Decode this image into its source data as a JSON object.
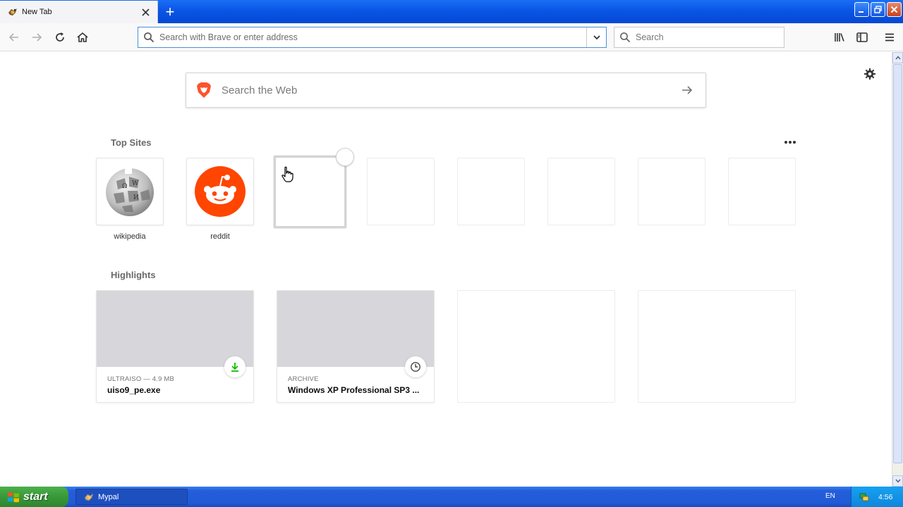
{
  "window": {
    "tab_title": "New Tab",
    "new_tab_symbol": "+"
  },
  "toolbar": {
    "address_placeholder": "Search with Brave or enter address",
    "search_placeholder": "Search"
  },
  "content": {
    "web_search_placeholder": "Search the Web",
    "top_sites_title": "Top Sites",
    "top_sites": [
      {
        "label": "wikipedia",
        "icon": "wikipedia-globe-icon"
      },
      {
        "label": "reddit",
        "icon": "reddit-alien-icon"
      }
    ],
    "highlights_title": "Highlights",
    "highlights": [
      {
        "meta": "ULTRAISO — 4.9 MB",
        "title": "uiso9_pe.exe",
        "badge_icon": "download-icon"
      },
      {
        "meta": "ARCHIVE",
        "title": "Windows XP Professional SP3 ...",
        "badge_icon": "clock-icon"
      }
    ]
  },
  "taskbar": {
    "start_label": "start",
    "task_label": "Mypal",
    "language": "EN",
    "clock": "4:56"
  },
  "colors": {
    "accent": "#0a84ff",
    "reddit": "#ff4500",
    "download_green": "#12bc00"
  }
}
